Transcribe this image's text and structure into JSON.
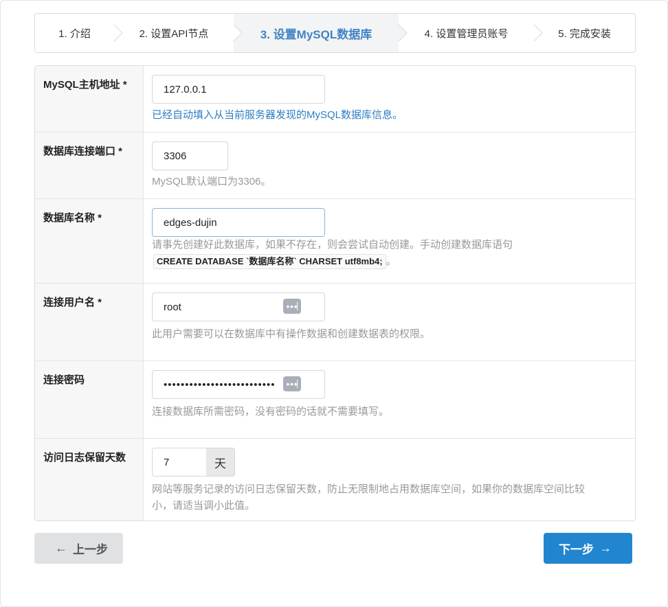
{
  "steps": [
    {
      "label": "1. 介绍"
    },
    {
      "label": "2. 设置API节点"
    },
    {
      "label": "3. 设置MySQL数据库"
    },
    {
      "label": "4. 设置管理员账号"
    },
    {
      "label": "5. 完成安装"
    }
  ],
  "active_step": 3,
  "fields": {
    "host": {
      "label": "MySQL主机地址 *",
      "value": "127.0.0.1",
      "help": "已经自动填入从当前服务器发现的MySQL数据库信息。"
    },
    "port": {
      "label": "数据库连接端口 *",
      "value": "3306",
      "help": "MySQL默认端口为3306。"
    },
    "dbname": {
      "label": "数据库名称 *",
      "value": "edges-dujin",
      "help_prefix": "请事先创建好此数据库，如果不存在，则会尝试自动创建。手动创建数据库语句",
      "help_code": "CREATE DATABASE `数据库名称` CHARSET utf8mb4;",
      "help_suffix": "。"
    },
    "username": {
      "label": "连接用户名 *",
      "value": "root",
      "help": "此用户需要可以在数据库中有操作数据和创建数据表的权限。"
    },
    "password": {
      "label": "连接密码",
      "value": "••••••••••••••••••••••••••",
      "help": "连接数据库所需密码，没有密码的话就不需要填写。"
    },
    "log_days": {
      "label": "访问日志保留天数",
      "value": "7",
      "unit": "天",
      "help_line1": "网站等服务记录的访问日志保留天数，防止无限制地占用数据库空间，如果你的数据库空间比较",
      "help_line2": "小，请适当调小此值。"
    }
  },
  "buttons": {
    "prev": "上一步",
    "next": "下一步"
  },
  "colors": {
    "accent": "#2185d0",
    "active_step_text": "#4183c4",
    "help_blue": "#2f7dc2"
  },
  "icons": {
    "password_manager": "password-manager-icon",
    "prev": "arrow-left-icon",
    "next": "arrow-right-icon"
  }
}
